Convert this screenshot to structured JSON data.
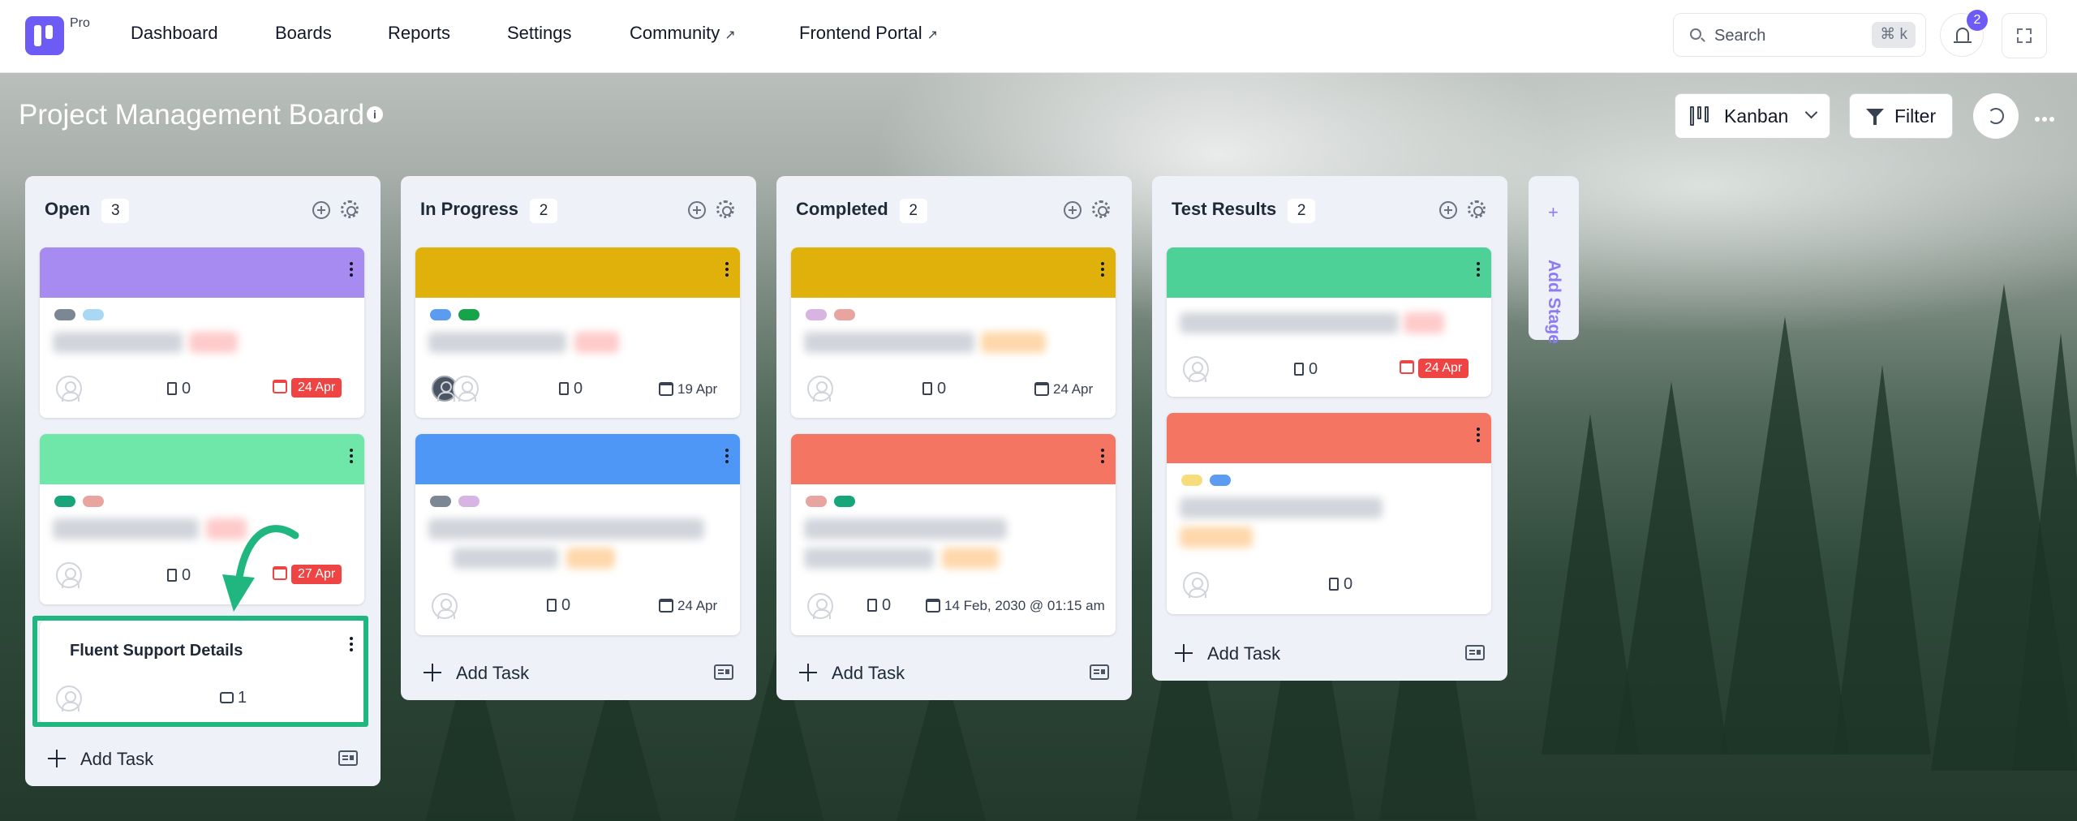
{
  "nav": {
    "pro_label": "Pro",
    "items": [
      {
        "label": "Dashboard",
        "external": false
      },
      {
        "label": "Boards",
        "external": false
      },
      {
        "label": "Reports",
        "external": false
      },
      {
        "label": "Settings",
        "external": false
      },
      {
        "label": "Community",
        "external": true
      },
      {
        "label": "Frontend Portal",
        "external": true
      }
    ],
    "external_glyph": "↗",
    "search_placeholder": "Search",
    "search_shortcut": "⌘ k",
    "notification_count": "2"
  },
  "board": {
    "title": "Project Management Board",
    "view_label": "Kanban",
    "filter_label": "Filter"
  },
  "columns": [
    {
      "name": "Open",
      "count": "3",
      "cards": [
        {
          "cover": "#a78bf0",
          "labels": [
            "#7c8794",
            "#a9d8f5"
          ],
          "comments_count": "0",
          "due": "24 Apr",
          "overdue": true
        },
        {
          "cover": "#6ee7a8",
          "labels": [
            "#17a67a",
            "#e8a5a0"
          ],
          "comments_count": "0",
          "due": "27 Apr",
          "overdue": true
        },
        {
          "title": "Fluent Support Details",
          "comments_count": "1"
        }
      ],
      "add_task_label": "Add Task"
    },
    {
      "name": "In Progress",
      "count": "2",
      "cards": [
        {
          "cover": "#e0b10b",
          "labels": [
            "#5b9cf0",
            "#17a34a"
          ],
          "comments_count": "0",
          "due": "19 Apr",
          "overdue": false
        },
        {
          "cover": "#4f97f7",
          "labels": [
            "#7c8794",
            "#d8b4e2"
          ],
          "comments_count": "0",
          "due": "24 Apr",
          "overdue": false
        }
      ],
      "add_task_label": "Add Task"
    },
    {
      "name": "Completed",
      "count": "2",
      "cards": [
        {
          "cover": "#e0b10b",
          "labels": [
            "#d8b4e2",
            "#e8a5a0"
          ],
          "comments_count": "0",
          "due": "24 Apr",
          "overdue": false
        },
        {
          "cover": "#f47561",
          "labels": [
            "#e8a5a0",
            "#17a67a"
          ],
          "comments_count": "0",
          "due": "14 Feb, 2030 @ 01:15 am",
          "overdue": false
        }
      ],
      "add_task_label": "Add Task"
    },
    {
      "name": "Test Results",
      "count": "2",
      "cards": [
        {
          "cover": "#4dd196",
          "comments_count": "0",
          "due": "24 Apr",
          "overdue": true
        },
        {
          "cover": "#f47561",
          "labels": [
            "#f6dd7a",
            "#5b9cf0"
          ],
          "comments_count": "0"
        }
      ],
      "add_task_label": "Add Task"
    }
  ],
  "add_stage_label": "Add Stage",
  "colors": {
    "accent": "#6d5bf6",
    "highlight": "#1fb77f",
    "overdue": "#ef4444"
  }
}
